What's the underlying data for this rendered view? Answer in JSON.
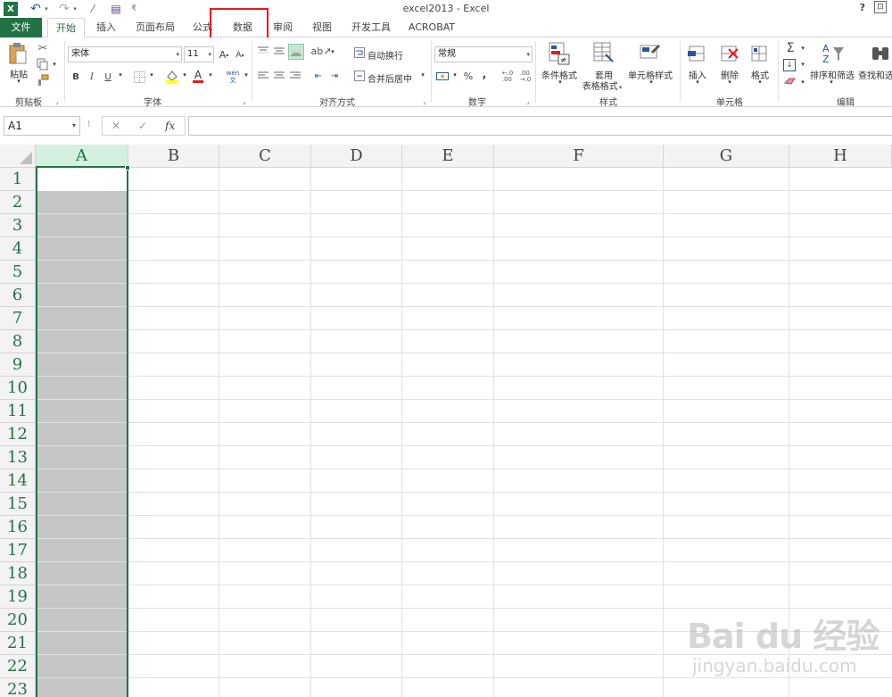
{
  "titlebar": {
    "app_title": "excel2013 - Excel",
    "help": "?",
    "ribbon_options": "⊡",
    "quick_access": {
      "excel_icon": "X",
      "undo": "↶",
      "redo": "↷",
      "customize": "⁄",
      "save": "▤",
      "more": "₹"
    }
  },
  "tabs": {
    "file": "文件",
    "items": [
      "开始",
      "插入",
      "页面布局",
      "公式",
      "数据",
      "审阅",
      "视图",
      "开发工具",
      "ACROBAT"
    ],
    "active": "开始",
    "highlighted": "数据"
  },
  "ribbon": {
    "clipboard": {
      "label": "剪贴板",
      "paste": "粘贴"
    },
    "font": {
      "label": "字体",
      "font_name": "宋体",
      "font_size": "11",
      "grow": "A",
      "shrink": "A",
      "bold": "B",
      "italic": "I",
      "underline": "U",
      "phonetic": "wén\n文"
    },
    "alignment": {
      "label": "对齐方式",
      "wrap_text": "自动换行",
      "merge_center": "合并后居中"
    },
    "number": {
      "label": "数字",
      "format": "常规",
      "percent": "%",
      "comma": ",",
      "inc_decimal": "←.0\n.00",
      "dec_decimal": ".00\n→.0"
    },
    "styles": {
      "label": "样式",
      "conditional": "条件格式",
      "table_format_1": "套用",
      "table_format_2": "表格格式",
      "cell_styles": "单元格样式"
    },
    "cells": {
      "label": "单元格",
      "insert": "插入",
      "delete": "删除",
      "format": "格式"
    },
    "editing": {
      "label": "编辑",
      "sort_filter": "排序和筛选",
      "find_select": "查找和选"
    }
  },
  "formula_bar": {
    "name_box": "A1",
    "more": "⁝",
    "cancel": "✕",
    "enter": "✓",
    "fx": "fx",
    "value": ""
  },
  "sheet": {
    "columns": [
      "A",
      "B",
      "C",
      "D",
      "E",
      "F",
      "G",
      "H"
    ],
    "rows": [
      "1",
      "2",
      "3",
      "4",
      "5",
      "6",
      "7",
      "8",
      "9",
      "10",
      "11",
      "12",
      "13",
      "14",
      "15",
      "16",
      "17",
      "18",
      "19",
      "20",
      "21",
      "22",
      "23"
    ],
    "selected_column": "A",
    "active_cell": "A1"
  },
  "watermark": {
    "logo": "Bai du 经验",
    "url": "jingyan.baidu.com"
  },
  "colors": {
    "accent": "#217346",
    "highlight_box": "#e41b1b",
    "selection_fill": "#c6c6c6"
  }
}
